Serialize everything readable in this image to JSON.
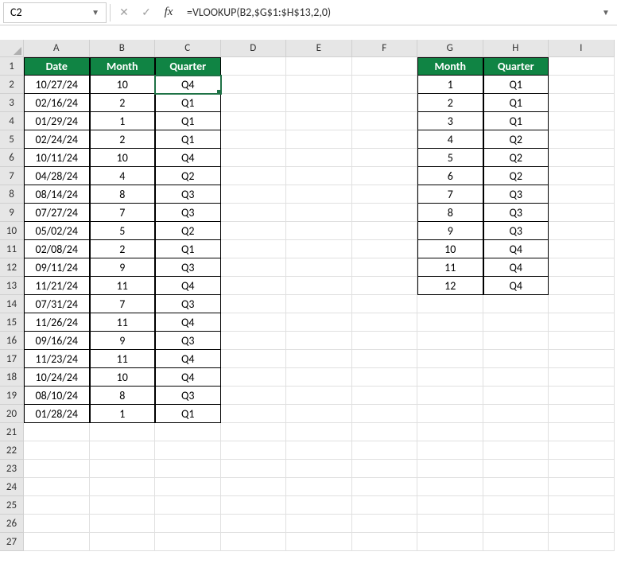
{
  "nameBox": "C2",
  "formula": "=VLOOKUP(B2,$G$1:$H$13,2,0)",
  "columns": [
    "A",
    "B",
    "C",
    "D",
    "E",
    "F",
    "G",
    "H",
    "I"
  ],
  "rowCount": 27,
  "selectedCell": {
    "row": 2,
    "col": 3
  },
  "headers1": {
    "A": "Date",
    "B": "Month",
    "C": "Quarter"
  },
  "headers2": {
    "G": "Month",
    "H": "Quarter"
  },
  "table1": [
    {
      "date": "10/27/24",
      "month": "10",
      "quarter": "Q4"
    },
    {
      "date": "02/16/24",
      "month": "2",
      "quarter": "Q1"
    },
    {
      "date": "01/29/24",
      "month": "1",
      "quarter": "Q1"
    },
    {
      "date": "02/24/24",
      "month": "2",
      "quarter": "Q1"
    },
    {
      "date": "10/11/24",
      "month": "10",
      "quarter": "Q4"
    },
    {
      "date": "04/28/24",
      "month": "4",
      "quarter": "Q2"
    },
    {
      "date": "08/14/24",
      "month": "8",
      "quarter": "Q3"
    },
    {
      "date": "07/27/24",
      "month": "7",
      "quarter": "Q3"
    },
    {
      "date": "05/02/24",
      "month": "5",
      "quarter": "Q2"
    },
    {
      "date": "02/08/24",
      "month": "2",
      "quarter": "Q1"
    },
    {
      "date": "09/11/24",
      "month": "9",
      "quarter": "Q3"
    },
    {
      "date": "11/21/24",
      "month": "11",
      "quarter": "Q4"
    },
    {
      "date": "07/31/24",
      "month": "7",
      "quarter": "Q3"
    },
    {
      "date": "11/26/24",
      "month": "11",
      "quarter": "Q4"
    },
    {
      "date": "09/16/24",
      "month": "9",
      "quarter": "Q3"
    },
    {
      "date": "11/23/24",
      "month": "11",
      "quarter": "Q4"
    },
    {
      "date": "10/24/24",
      "month": "10",
      "quarter": "Q4"
    },
    {
      "date": "08/10/24",
      "month": "8",
      "quarter": "Q3"
    },
    {
      "date": "01/28/24",
      "month": "1",
      "quarter": "Q1"
    }
  ],
  "table2": [
    {
      "month": "1",
      "quarter": "Q1"
    },
    {
      "month": "2",
      "quarter": "Q1"
    },
    {
      "month": "3",
      "quarter": "Q1"
    },
    {
      "month": "4",
      "quarter": "Q2"
    },
    {
      "month": "5",
      "quarter": "Q2"
    },
    {
      "month": "6",
      "quarter": "Q2"
    },
    {
      "month": "7",
      "quarter": "Q3"
    },
    {
      "month": "8",
      "quarter": "Q3"
    },
    {
      "month": "9",
      "quarter": "Q3"
    },
    {
      "month": "10",
      "quarter": "Q4"
    },
    {
      "month": "11",
      "quarter": "Q4"
    },
    {
      "month": "12",
      "quarter": "Q4"
    }
  ]
}
